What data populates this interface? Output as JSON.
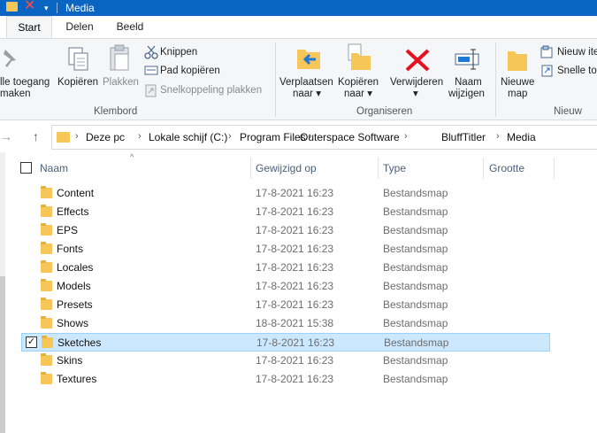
{
  "window": {
    "title": "Media"
  },
  "tabs": [
    {
      "label": "Start",
      "active": true
    },
    {
      "label": "Delen",
      "active": false
    },
    {
      "label": "Beeld",
      "active": false
    }
  ],
  "ribbon": {
    "klembord": {
      "label": "Klembord",
      "pin_line1": "lle toegang",
      "pin_line2": "maken",
      "copy": "Kopiëren",
      "paste": "Plakken",
      "cut": "Knippen",
      "copy_path": "Pad kopiëren",
      "paste_shortcut": "Snelkoppeling plakken"
    },
    "organiseren": {
      "label": "Organiseren",
      "move_line1": "Verplaatsen",
      "move_line2": "naar",
      "copyto_line1": "Kopiëren",
      "copyto_line2": "naar",
      "delete": "Verwijderen",
      "rename_line1": "Naam",
      "rename_line2": "wijzigen"
    },
    "nieuw": {
      "label": "Nieuw",
      "newfolder_line1": "Nieuwe",
      "newfolder_line2": "map",
      "new_item": "Nieuw ite",
      "easy_access": "Snelle to"
    }
  },
  "breadcrumb": [
    "Deze pc",
    "Lokale schijf (C:)",
    "Program Files",
    "Outerspace Software",
    "BluffTitler",
    "Media"
  ],
  "columns": {
    "name": "Naam",
    "modified": "Gewijzigd op",
    "type": "Type",
    "size": "Grootte"
  },
  "files": [
    {
      "name": "Content",
      "date": "17-8-2021 16:23",
      "type": "Bestandsmap",
      "selected": false
    },
    {
      "name": "Effects",
      "date": "17-8-2021 16:23",
      "type": "Bestandsmap",
      "selected": false
    },
    {
      "name": "EPS",
      "date": "17-8-2021 16:23",
      "type": "Bestandsmap",
      "selected": false
    },
    {
      "name": "Fonts",
      "date": "17-8-2021 16:23",
      "type": "Bestandsmap",
      "selected": false
    },
    {
      "name": "Locales",
      "date": "17-8-2021 16:23",
      "type": "Bestandsmap",
      "selected": false
    },
    {
      "name": "Models",
      "date": "17-8-2021 16:23",
      "type": "Bestandsmap",
      "selected": false
    },
    {
      "name": "Presets",
      "date": "17-8-2021 16:23",
      "type": "Bestandsmap",
      "selected": false
    },
    {
      "name": "Shows",
      "date": "18-8-2021 15:38",
      "type": "Bestandsmap",
      "selected": false
    },
    {
      "name": "Sketches",
      "date": "17-8-2021 16:23",
      "type": "Bestandsmap",
      "selected": true
    },
    {
      "name": "Skins",
      "date": "17-8-2021 16:23",
      "type": "Bestandsmap",
      "selected": false
    },
    {
      "name": "Textures",
      "date": "17-8-2021 16:23",
      "type": "Bestandsmap",
      "selected": false
    }
  ],
  "icons": {
    "titlebar": [
      "folder-icon",
      "close-x-icon",
      "dropdown-icon"
    ],
    "ribbon": [
      "pin-icon",
      "copy-icon",
      "paste-icon",
      "scissors-icon",
      "copy-path-icon",
      "paste-shortcut-icon",
      "move-to-icon",
      "copy-to-icon",
      "delete-icon",
      "rename-icon",
      "new-folder-icon",
      "new-item-icon",
      "easy-access-icon"
    ],
    "nav": [
      "back-arrow-icon",
      "up-arrow-icon"
    ]
  },
  "colors": {
    "titlebar": "#0a64c2",
    "selection": "#cce8ff",
    "selection_border": "#99d1ff",
    "folder": "#f6c659",
    "delete_red": "#e81123"
  }
}
